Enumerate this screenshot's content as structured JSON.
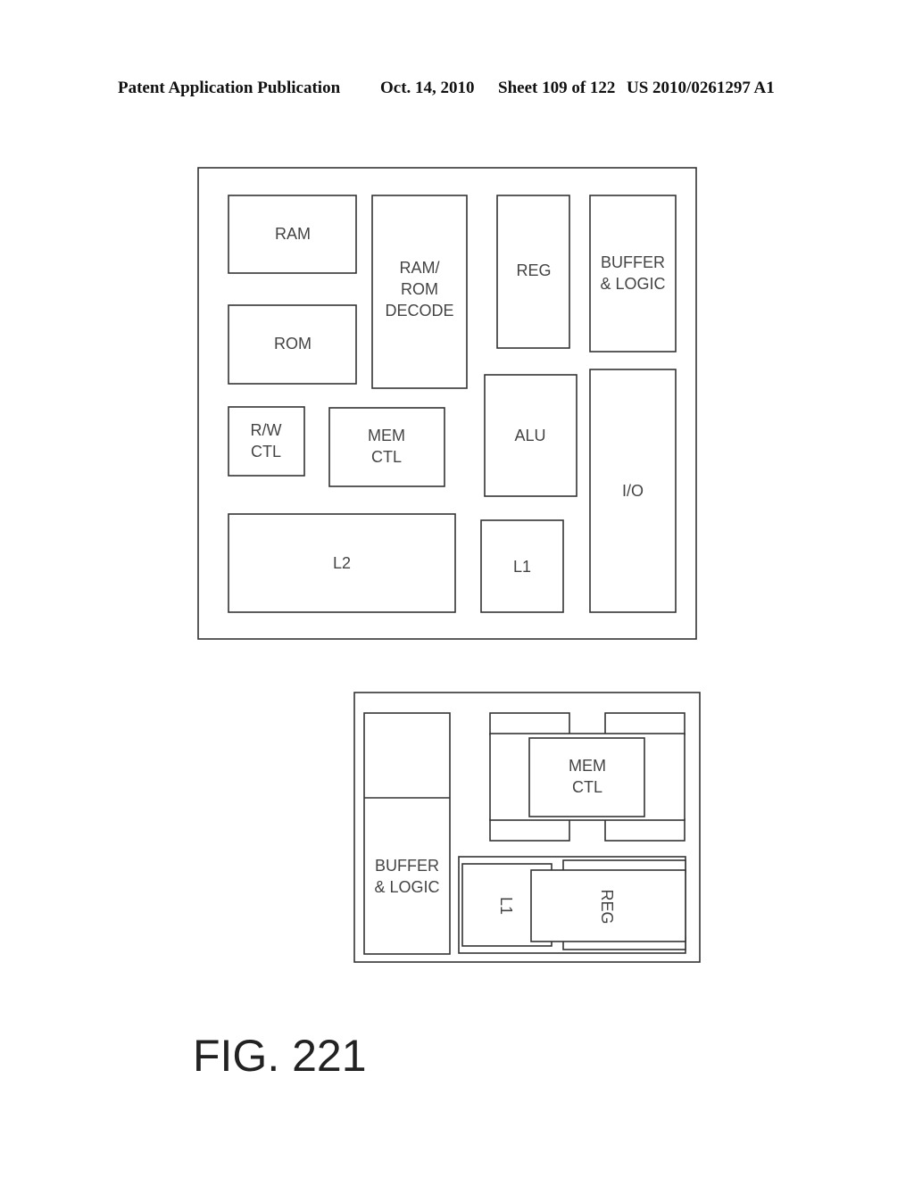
{
  "header": {
    "publication": "Patent Application Publication",
    "date": "Oct. 14, 2010",
    "sheet": "Sheet 109 of 122",
    "number": "US 2010/0261297 A1"
  },
  "figure_a": {
    "blocks": {
      "ram": [
        "RAM"
      ],
      "ram_rom_decode": [
        "RAM/",
        "ROM",
        "DECODE"
      ],
      "reg": [
        "REG"
      ],
      "buffer_logic": [
        "BUFFER",
        "& LOGIC"
      ],
      "rom": [
        "ROM"
      ],
      "rw_ctl": [
        "R/W",
        "CTL"
      ],
      "mem_ctl": [
        "MEM",
        "CTL"
      ],
      "alu": [
        "ALU"
      ],
      "io": [
        "I/O"
      ],
      "l2": [
        "L2"
      ],
      "l1": [
        "L1"
      ]
    }
  },
  "figure_b": {
    "blocks": {
      "buffer_logic": [
        "BUFFER",
        "& LOGIC"
      ],
      "mem_ctl": [
        "MEM",
        "CTL"
      ],
      "l1": "L1",
      "reg": "REG"
    }
  },
  "caption": "FIG. 221"
}
